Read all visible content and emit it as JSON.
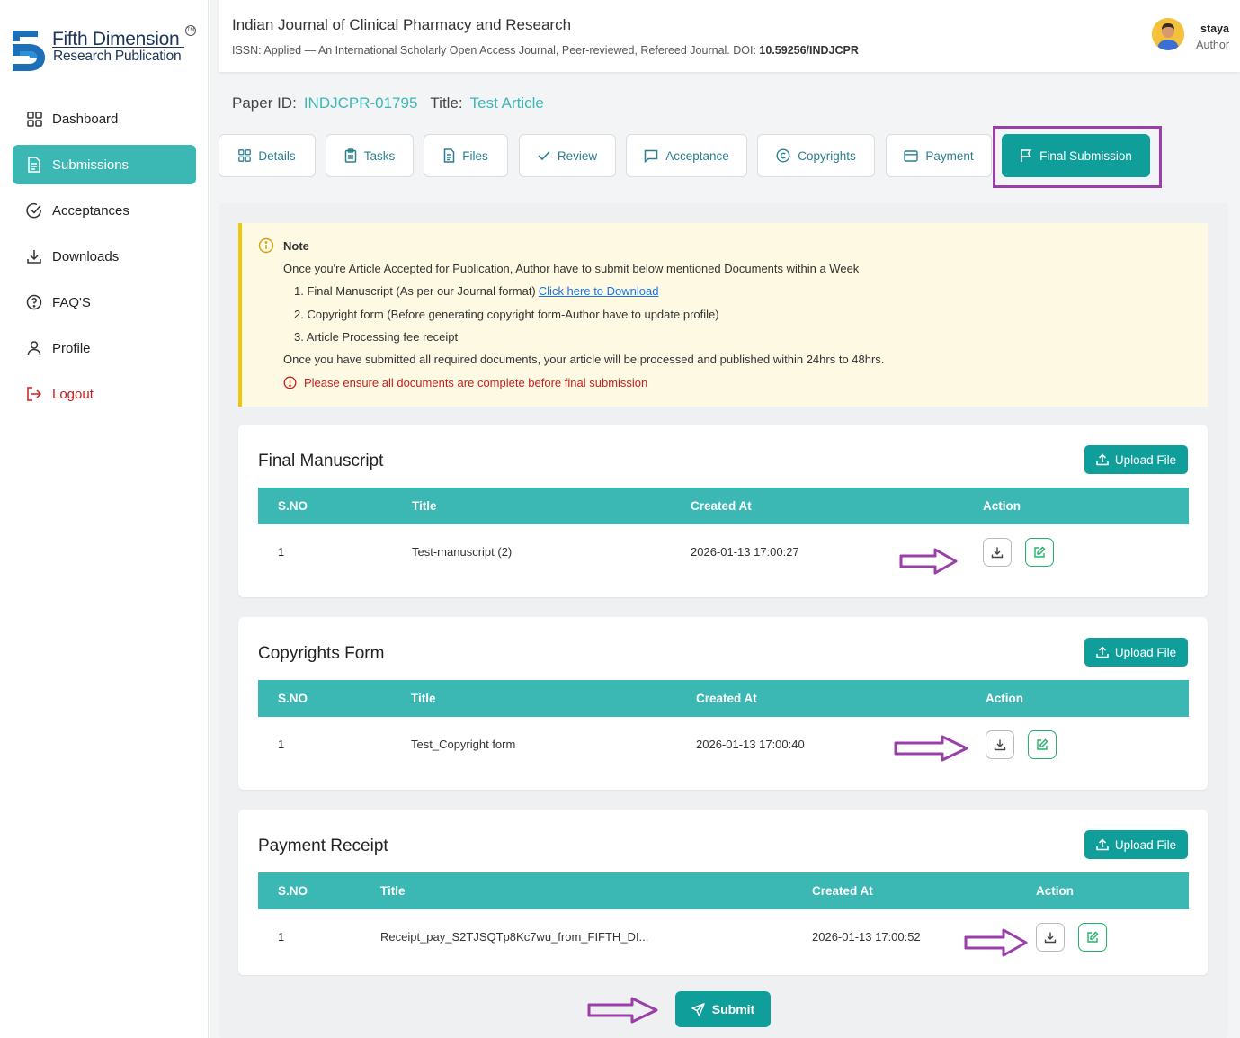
{
  "brand": {
    "name_line1": "Fifth Dimension",
    "name_line2": "Research Publication",
    "tm": "TM"
  },
  "sidebar": {
    "items": [
      {
        "label": "Dashboard",
        "icon": "grid-icon"
      },
      {
        "label": "Submissions",
        "icon": "document-icon",
        "active": true
      },
      {
        "label": "Acceptances",
        "icon": "check-circle-icon"
      },
      {
        "label": "Downloads",
        "icon": "download-icon"
      },
      {
        "label": "FAQ'S",
        "icon": "help-circle-icon"
      },
      {
        "label": "Profile",
        "icon": "user-icon"
      },
      {
        "label": "Logout",
        "icon": "logout-icon"
      }
    ]
  },
  "header": {
    "journal_title": "Indian Journal of Clinical Pharmacy and Research",
    "journal_sub": "ISSN: Applied — An International Scholarly Open Access Journal, Peer-reviewed, Refereed Journal. DOI: ",
    "doi": "10.59256/INDJCPR",
    "user_name": "staya",
    "user_role": "Author"
  },
  "paper": {
    "id_label": "Paper ID:",
    "id_value": "INDJCPR-01795",
    "title_label": "Title:",
    "title_value": "Test Article"
  },
  "tabs": [
    {
      "label": "Details",
      "icon": "grid-icon"
    },
    {
      "label": "Tasks",
      "icon": "clipboard-icon"
    },
    {
      "label": "Files",
      "icon": "file-icon"
    },
    {
      "label": "Review",
      "icon": "check-icon"
    },
    {
      "label": "Acceptance",
      "icon": "message-icon"
    },
    {
      "label": "Copyrights",
      "icon": "copyright-icon"
    },
    {
      "label": "Payment",
      "icon": "card-icon"
    },
    {
      "label": "Final Submission",
      "icon": "flag-icon",
      "active": true
    }
  ],
  "note": {
    "heading": "Note",
    "intro": "Once you're Article Accepted for Publication, Author have to submit below mentioned Documents within a Week",
    "item1": "1. Final Manuscript (As per our Journal format)",
    "item1_link": "Click here to Download",
    "item2": "2. Copyright form (Before generating copyright form-Author have to update profile)",
    "item3": "3. Article Processing fee receipt",
    "outro": "Once you have submitted all required documents, your article will be processed and published within 24hrs to 48hrs.",
    "warning": "Please ensure all documents are complete before final submission"
  },
  "sections": [
    {
      "title": "Final Manuscript",
      "upload_label": "Upload File",
      "columns": [
        "S.NO",
        "Title",
        "Created At",
        "Action"
      ],
      "rows": [
        {
          "sno": "1",
          "title": "Test-manuscript (2)",
          "created": "2026-01-13 17:00:27"
        }
      ]
    },
    {
      "title": "Copyrights Form",
      "upload_label": "Upload File",
      "columns": [
        "S.NO",
        "Title",
        "Created At",
        "Action"
      ],
      "rows": [
        {
          "sno": "1",
          "title": "Test_Copyright form",
          "created": "2026-01-13 17:00:40"
        }
      ]
    },
    {
      "title": "Payment Receipt",
      "upload_label": "Upload File",
      "columns": [
        "S.NO",
        "Title",
        "Created At",
        "Action"
      ],
      "rows": [
        {
          "sno": "1",
          "title": "Receipt_pay_S2TJSQTp8Kc7wu_from_FIFTH_DI...",
          "created": "2026-01-13 17:00:52"
        }
      ]
    }
  ],
  "submit_label": "Submit",
  "colors": {
    "accent": "#3bb8b4",
    "accent_dark": "#0f9e9a",
    "annotation": "#9b3fa8",
    "warning": "#c81e1e",
    "note_bg": "#fef9e2"
  }
}
